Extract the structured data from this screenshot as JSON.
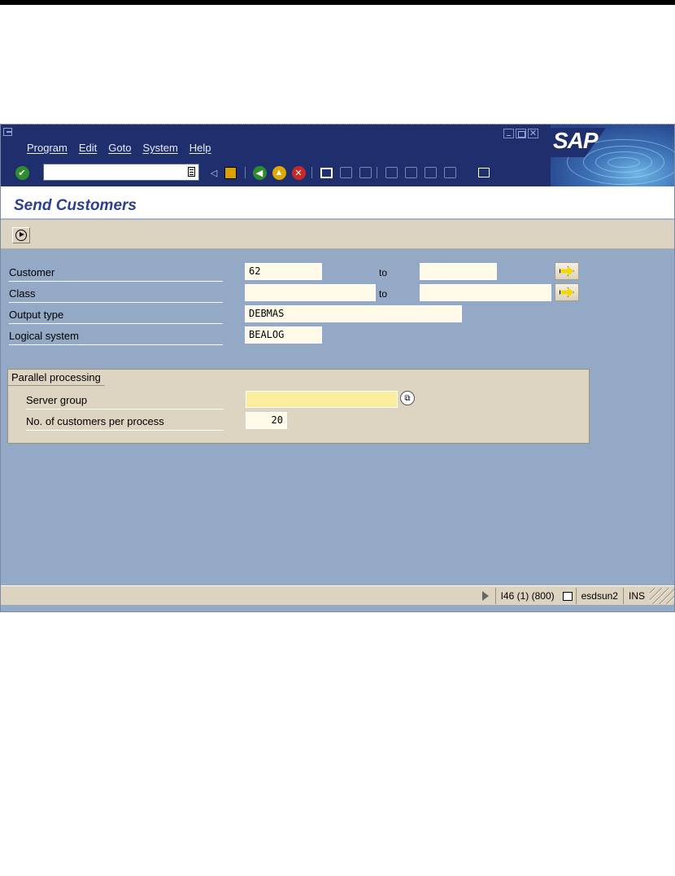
{
  "menu": {
    "items": [
      "Program",
      "Edit",
      "Goto",
      "System",
      "Help"
    ]
  },
  "toolbar": {
    "command_field_value": ""
  },
  "logo": {
    "text": "SAP"
  },
  "screen": {
    "title": "Send Customers"
  },
  "form": {
    "customer": {
      "label": "Customer",
      "from": "62",
      "to_label": "to",
      "to": ""
    },
    "class": {
      "label": "Class",
      "from": "",
      "to_label": "to",
      "to": ""
    },
    "output_type": {
      "label": "Output type",
      "value": "DEBMAS"
    },
    "logical_system": {
      "label": "Logical system",
      "value": "BEALOG"
    }
  },
  "parallel": {
    "title": "Parallel processing",
    "server_group": {
      "label": "Server group",
      "value": ""
    },
    "customers_per_process": {
      "label": "No. of customers per process",
      "value": "20"
    }
  },
  "status": {
    "system": "I46 (1) (800)",
    "server": "esdsun2",
    "mode": "INS"
  }
}
